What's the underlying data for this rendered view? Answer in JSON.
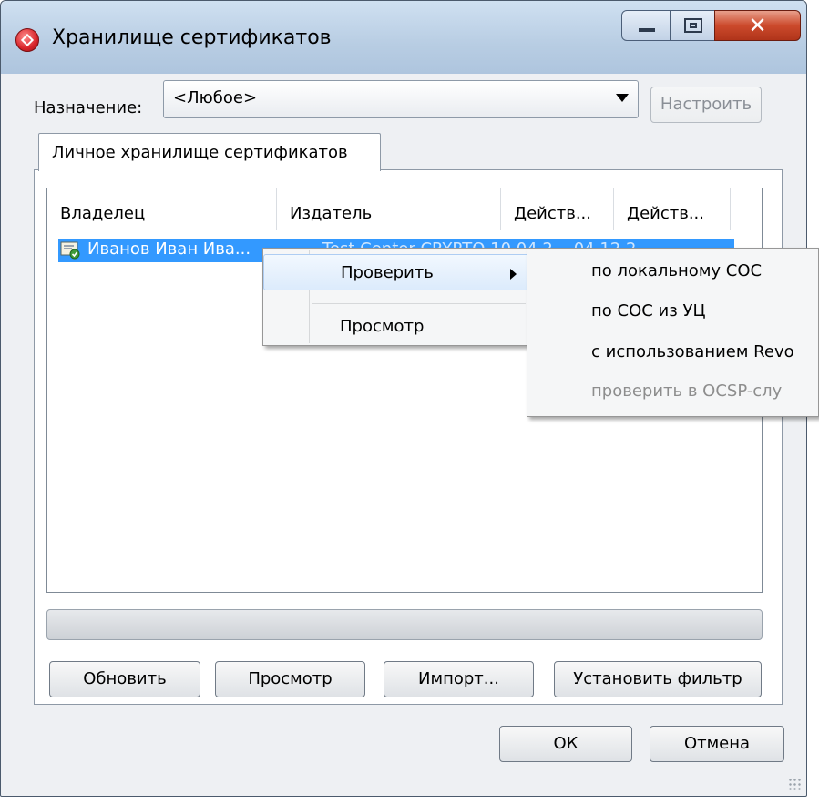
{
  "window": {
    "title": "Хранилище сертификатов"
  },
  "purpose": {
    "label": "Назначение:",
    "selected": "<Любое>",
    "configure_label": "Настроить"
  },
  "tabs": [
    {
      "label": "Личное хранилище сертификатов"
    }
  ],
  "table": {
    "columns": [
      "Владелец",
      "Издатель",
      "Действ...",
      "Действ..."
    ],
    "rows": [
      {
        "owner": "Иванов Иван Ива...",
        "rest": "Test Center CRYPTO   10.04.2...   04.12.2..."
      }
    ]
  },
  "context_menu": {
    "items": [
      {
        "label": "Проверить",
        "has_submenu": true
      },
      {
        "label": "Просмотр"
      }
    ]
  },
  "submenu": {
    "items": [
      {
        "label": "по локальному СОС"
      },
      {
        "label": "по СОС из УЦ"
      },
      {
        "label": "с использованием Revo"
      },
      {
        "label": "проверить в OCSP-слу",
        "disabled": true
      }
    ]
  },
  "buttons": {
    "refresh": "Обновить",
    "view": "Просмотр",
    "import": "Импорт...",
    "filter": "Установить фильтр",
    "ok": "ОК",
    "cancel": "Отмена"
  }
}
